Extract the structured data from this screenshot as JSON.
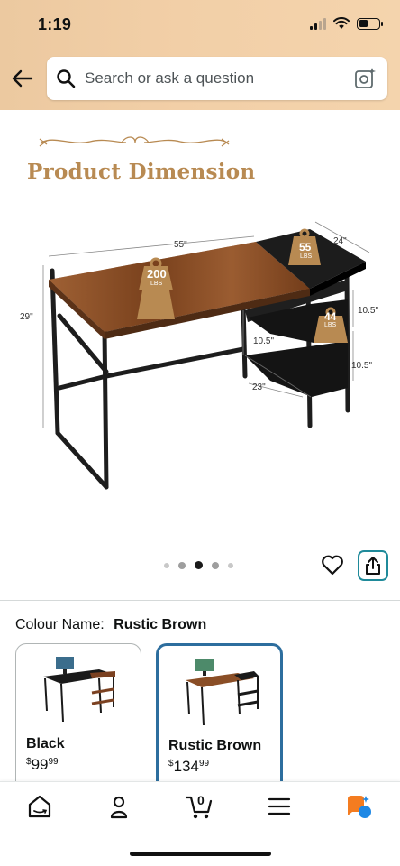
{
  "status_bar": {
    "time": "1:19"
  },
  "search": {
    "placeholder": "Search or ask a question"
  },
  "product_image": {
    "title": "Product Dimension",
    "dimensions": {
      "width": "55\"",
      "depth": "24\"",
      "height": "29\"",
      "shelf_spacing_top": "10.5\"",
      "shelf_spacing_bottom": "10.5\"",
      "shelf_height": "10.5\"",
      "shelf_width": "23\""
    },
    "weight_badges": [
      {
        "value": "200",
        "unit": "LBS"
      },
      {
        "value": "55",
        "unit": "LBS"
      },
      {
        "value": "44",
        "unit": "LBS"
      }
    ],
    "carousel": {
      "total": 5,
      "active_index": 2
    }
  },
  "colour": {
    "label": "Colour Name:",
    "value": "Rustic Brown"
  },
  "variants": [
    {
      "name": "Black",
      "price_symbol": "$",
      "price_whole": "99",
      "price_cents": "99",
      "selected": false
    },
    {
      "name": "Rustic Brown",
      "price_symbol": "$",
      "price_whole": "134",
      "price_cents": "99",
      "selected": true
    }
  ],
  "bottom_nav": {
    "items": [
      {
        "icon": "home-icon"
      },
      {
        "icon": "account-icon"
      },
      {
        "icon": "cart-icon",
        "badge": "0"
      },
      {
        "icon": "menu-icon"
      },
      {
        "icon": "rufus-icon"
      }
    ]
  },
  "colors": {
    "header_band": "#f2cfa7",
    "accent_teal": "#1f8a9a",
    "selected_border": "#2d6e9e",
    "title_tan": "#b88a52",
    "rufus_orange": "#f47c20",
    "rufus_blue": "#1e88e5"
  }
}
